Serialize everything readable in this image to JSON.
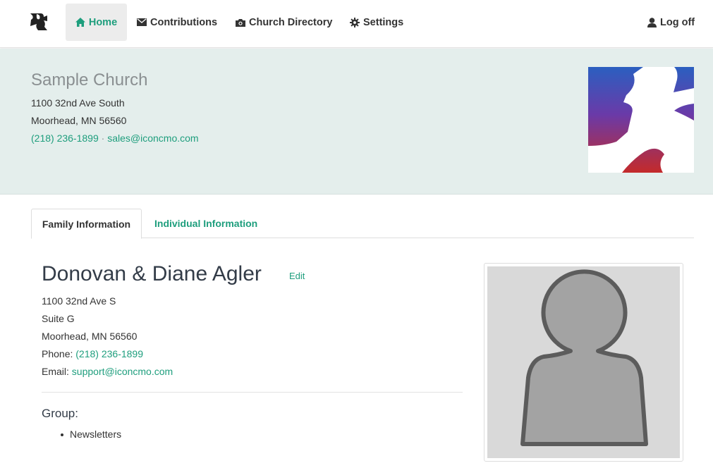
{
  "nav": {
    "home": "Home",
    "contributions": "Contributions",
    "directory": "Church Directory",
    "settings": "Settings",
    "logoff": "Log off"
  },
  "church": {
    "name": "Sample Church",
    "address_line1": "1100 32nd Ave South",
    "address_line2": "Moorhead, MN 56560",
    "phone": "(218) 236-1899",
    "separator": "·",
    "email": "sales@iconcmo.com"
  },
  "tabs": {
    "family": "Family Information",
    "individual": "Individual Information"
  },
  "family": {
    "name": "Donovan & Diane Agler",
    "edit": "Edit",
    "address_line1": "1100 32nd Ave S",
    "address_line2": "Suite G",
    "address_line3": "Moorhead, MN 56560",
    "phone_label": "Phone:",
    "phone": "(218) 236-1899",
    "email_label": "Email:",
    "email": "support@iconcmo.com",
    "group_heading": "Group:",
    "groups": [
      "Newsletters"
    ]
  },
  "colors": {
    "accent": "#1e9e7d",
    "banner_bg": "#e4eeec",
    "active_nav_bg": "#ececec"
  },
  "icons": {
    "brand": "church-logo-icon",
    "home": "home-icon",
    "contributions": "envelope-icon",
    "directory": "camera-icon",
    "settings": "gear-icon",
    "logoff": "user-icon",
    "photo": "avatar-placeholder-icon"
  }
}
